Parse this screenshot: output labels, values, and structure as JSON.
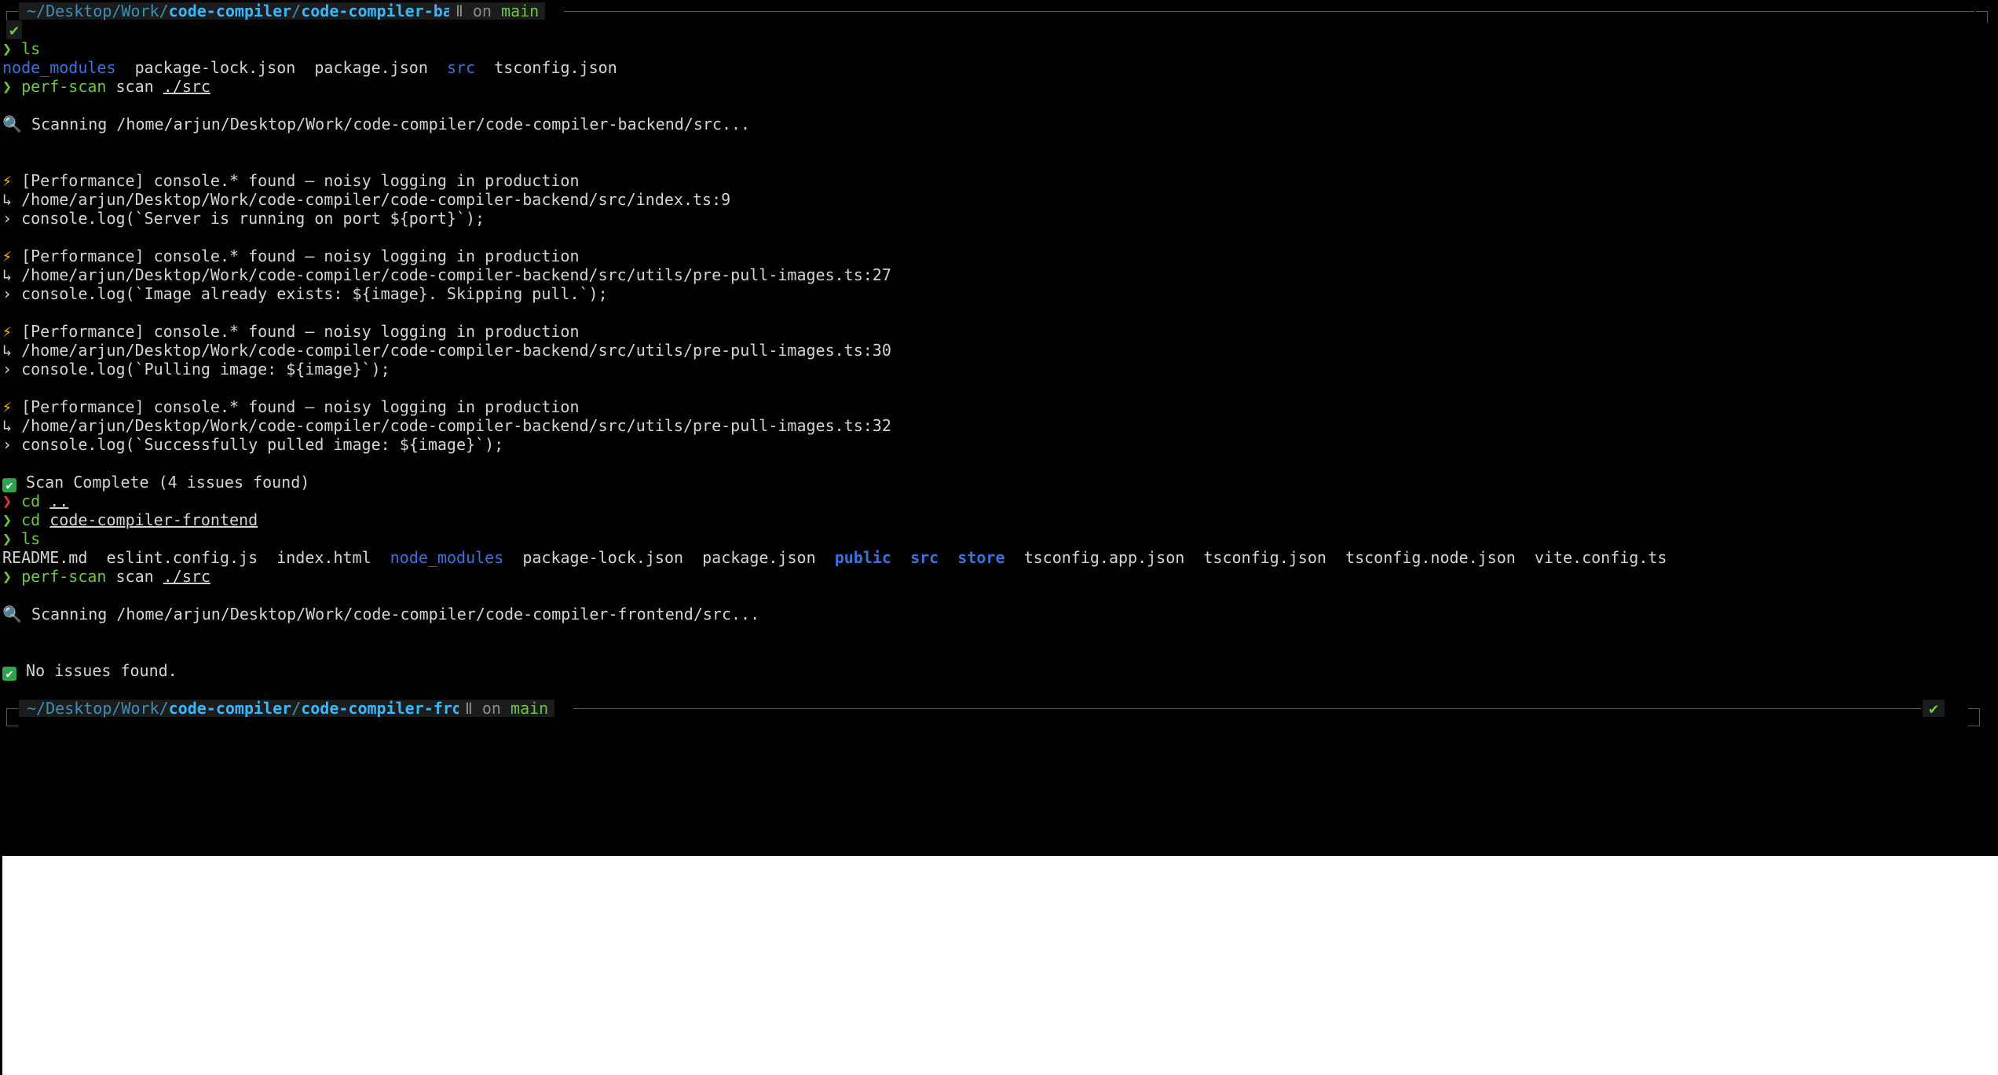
{
  "prompt1": {
    "path_prefix": "~/Desktop/Work/",
    "path_parent": "code-compiler",
    "path_sep": "/",
    "path_current": "code-compiler-backend",
    "git_icon": "Ⅱ",
    "git_on": "on",
    "branch": "main",
    "status_mark": "✔"
  },
  "block1": {
    "chevron": "❯",
    "cmd_ls": "ls",
    "ls_items": [
      {
        "name": "node_modules",
        "kind": "dir"
      },
      {
        "name": "package-lock.json",
        "kind": "file"
      },
      {
        "name": "package.json",
        "kind": "file"
      },
      {
        "name": "src",
        "kind": "dir"
      },
      {
        "name": "tsconfig.json",
        "kind": "file"
      }
    ],
    "scan_cmd": "perf-scan",
    "scan_sub": "scan",
    "scan_arg": "./src",
    "scanning_icon": "🔍",
    "scanning_text": "Scanning /home/arjun/Desktop/Work/code-compiler/code-compiler-backend/src...",
    "issues": [
      {
        "icon": "⚡",
        "title": "[Performance] console.* found — noisy logging in production",
        "file": "↳ /home/arjun/Desktop/Work/code-compiler/code-compiler-backend/src/index.ts:9",
        "code": "› console.log(`Server is running on port ${port}`);"
      },
      {
        "icon": "⚡",
        "title": "[Performance] console.* found — noisy logging in production",
        "file": "↳ /home/arjun/Desktop/Work/code-compiler/code-compiler-backend/src/utils/pre-pull-images.ts:27",
        "code": "› console.log(`Image already exists: ${image}. Skipping pull.`);"
      },
      {
        "icon": "⚡",
        "title": "[Performance] console.* found — noisy logging in production",
        "file": "↳ /home/arjun/Desktop/Work/code-compiler/code-compiler-backend/src/utils/pre-pull-images.ts:30",
        "code": "› console.log(`Pulling image: ${image}`);"
      },
      {
        "icon": "⚡",
        "title": "[Performance] console.* found — noisy logging in production",
        "file": "↳ /home/arjun/Desktop/Work/code-compiler/code-compiler-backend/src/utils/pre-pull-images.ts:32",
        "code": "› console.log(`Successfully pulled image: ${image}`);"
      }
    ],
    "complete_icon": "✔",
    "complete_text": "Scan Complete (4 issues found)"
  },
  "block2": {
    "chevron": "❯",
    "cd_cmd": "cd",
    "cd_arg1": "..",
    "cd_arg2": "code-compiler-frontend",
    "cmd_ls": "ls",
    "ls_items": [
      {
        "name": "README.md",
        "kind": "file"
      },
      {
        "name": "eslint.config.js",
        "kind": "file"
      },
      {
        "name": "index.html",
        "kind": "file"
      },
      {
        "name": "node_modules",
        "kind": "dir"
      },
      {
        "name": "package-lock.json",
        "kind": "file"
      },
      {
        "name": "package.json",
        "kind": "file"
      },
      {
        "name": "public",
        "kind": "dirb"
      },
      {
        "name": "src",
        "kind": "dirb"
      },
      {
        "name": "store",
        "kind": "dirb"
      },
      {
        "name": "tsconfig.app.json",
        "kind": "file"
      },
      {
        "name": "tsconfig.json",
        "kind": "file"
      },
      {
        "name": "tsconfig.node.json",
        "kind": "file"
      },
      {
        "name": "vite.config.ts",
        "kind": "file"
      }
    ],
    "scan_cmd": "perf-scan",
    "scan_sub": "scan",
    "scan_arg": "./src",
    "scanning_icon": "🔍",
    "scanning_text": "Scanning /home/arjun/Desktop/Work/code-compiler/code-compiler-frontend/src...",
    "result_icon": "✔",
    "result_text": "No issues found."
  },
  "prompt2": {
    "path_prefix": "~/Desktop/Work/",
    "path_parent": "code-compiler",
    "path_sep": "/",
    "path_current": "code-compiler-frontend",
    "git_icon": "Ⅱ",
    "git_on": "on",
    "branch": "main",
    "status_mark": "✔"
  },
  "colors": {
    "background": "#000000",
    "foreground": "#d4d4d4",
    "prompt_ok": "#6cc644",
    "prompt_err": "#e0393e",
    "dir": "#3b72d9",
    "cwd": "#38b6ff"
  }
}
